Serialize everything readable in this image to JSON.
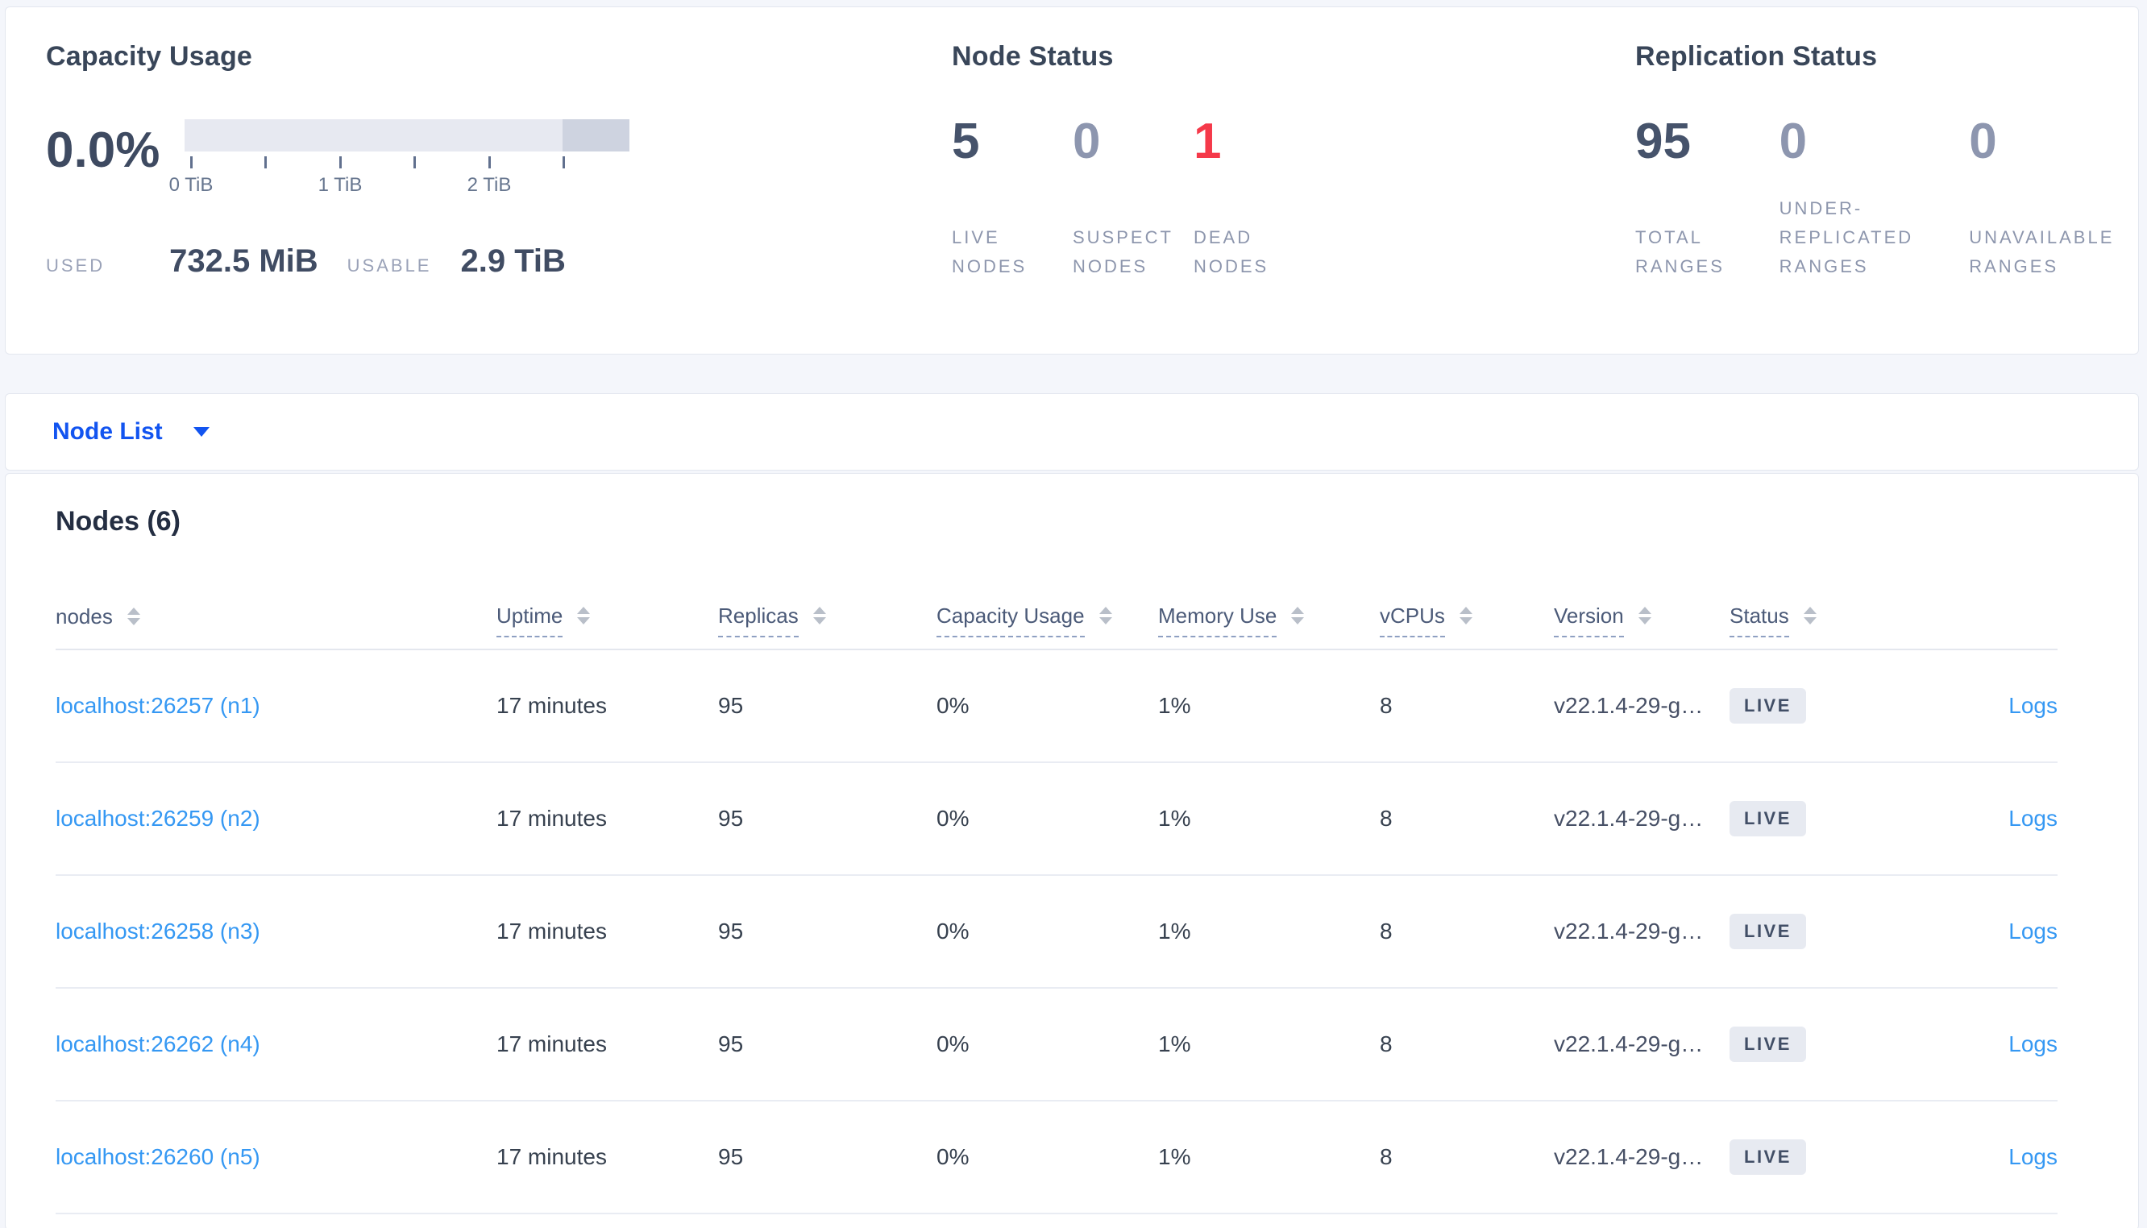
{
  "capacity": {
    "title": "Capacity Usage",
    "percent": "0.0%",
    "tick_labels": [
      "0 TiB",
      "1 TiB",
      "2 TiB"
    ],
    "used_label": "USED",
    "used_value": "732.5 MiB",
    "usable_label": "USABLE",
    "usable_value": "2.9 TiB"
  },
  "node_status": {
    "title": "Node Status",
    "live": {
      "value": "5",
      "label": "LIVE NODES"
    },
    "suspect": {
      "value": "0",
      "label": "SUSPECT NODES"
    },
    "dead": {
      "value": "1",
      "label": "DEAD NODES"
    }
  },
  "replication": {
    "title": "Replication Status",
    "total": {
      "value": "95",
      "label": "TOTAL RANGES"
    },
    "under": {
      "value": "0",
      "label": "UNDER-REPLICATED RANGES"
    },
    "unavailable": {
      "value": "0",
      "label": "UNAVAILABLE RANGES"
    }
  },
  "view_selector": {
    "label": "Node List"
  },
  "nodes": {
    "heading": "Nodes (6)",
    "columns": {
      "nodes": "nodes",
      "uptime": "Uptime",
      "replicas": "Replicas",
      "capacity": "Capacity Usage",
      "memory": "Memory Use",
      "vcpus": "vCPUs",
      "version": "Version",
      "status": "Status"
    },
    "rows": [
      {
        "name": "localhost:26257 (n1)",
        "uptime": "17 minutes",
        "replicas": "95",
        "capacity": "0%",
        "memory": "1%",
        "vcpus": "8",
        "version": "v22.1.4-29-g…",
        "status": "LIVE",
        "logs": "Logs"
      },
      {
        "name": "localhost:26259 (n2)",
        "uptime": "17 minutes",
        "replicas": "95",
        "capacity": "0%",
        "memory": "1%",
        "vcpus": "8",
        "version": "v22.1.4-29-g…",
        "status": "LIVE",
        "logs": "Logs"
      },
      {
        "name": "localhost:26258 (n3)",
        "uptime": "17 minutes",
        "replicas": "95",
        "capacity": "0%",
        "memory": "1%",
        "vcpus": "8",
        "version": "v22.1.4-29-g…",
        "status": "LIVE",
        "logs": "Logs"
      },
      {
        "name": "localhost:26262 (n4)",
        "uptime": "17 minutes",
        "replicas": "95",
        "capacity": "0%",
        "memory": "1%",
        "vcpus": "8",
        "version": "v22.1.4-29-g…",
        "status": "LIVE",
        "logs": "Logs"
      },
      {
        "name": "localhost:26260 (n5)",
        "uptime": "17 minutes",
        "replicas": "95",
        "capacity": "0%",
        "memory": "1%",
        "vcpus": "8",
        "version": "v22.1.4-29-g…",
        "status": "LIVE",
        "logs": "Logs"
      }
    ]
  },
  "colors": {
    "selector_blue": "#1254f0",
    "link_blue": "#3598f3",
    "dead_red": "#f5394a",
    "number_dark": "#46536b",
    "number_muted": "#8d96af"
  }
}
